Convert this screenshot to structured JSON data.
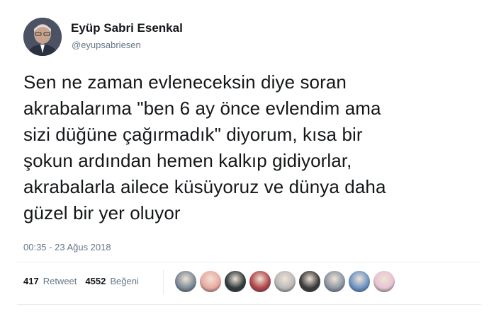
{
  "author": {
    "name": "Eyüp Sabri Esenkal",
    "handle": "@eyupsabriesen"
  },
  "tweet": {
    "text": "Sen ne zaman evleneceksin diye soran\nakrabalarıma \"ben 6 ay önce evlendim ama\nsizi düğüne çağırmadık\" diyorum, kısa bir\nşokun ardından hemen kalkıp gidiyorlar,\nakrabalarla ailece küsüyoruz ve dünya daha\ngüzel bir yer oluyor",
    "timestamp": "00:35 - 23 Ağus 2018"
  },
  "stats": {
    "retweet_count": "417",
    "retweet_label": "Retweet",
    "like_count": "4552",
    "like_label": "Beğeni"
  },
  "likers": [
    {
      "icon": "liker-avatar-1",
      "color": "#7a8a96"
    },
    {
      "icon": "liker-avatar-2",
      "color": "#e9a9a0"
    },
    {
      "icon": "liker-avatar-3",
      "color": "#2f3a3c"
    },
    {
      "icon": "liker-avatar-4",
      "color": "#b0464a"
    },
    {
      "icon": "liker-avatar-5",
      "color": "#b9b9b9"
    },
    {
      "icon": "liker-avatar-6",
      "color": "#3b3b3b"
    },
    {
      "icon": "liker-avatar-7",
      "color": "#8b96a3"
    },
    {
      "icon": "liker-avatar-8",
      "color": "#6b93c4"
    },
    {
      "icon": "liker-avatar-9",
      "color": "#e6c3d2"
    }
  ]
}
